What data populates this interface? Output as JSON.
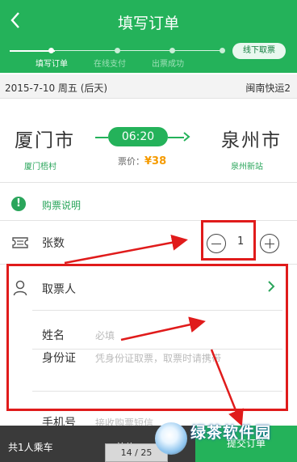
{
  "header": {
    "back_icon": "chevron-left-icon",
    "title": "填写订单"
  },
  "steps": {
    "items": [
      {
        "label": "填写订单",
        "active": true
      },
      {
        "label": "在线支付",
        "active": false
      },
      {
        "label": "出票成功",
        "active": false
      }
    ],
    "offline_button": "线下取票"
  },
  "trip": {
    "date": "2015-7-10 周五 (后天)",
    "company": "闽南快运2",
    "from_city": "厦门市",
    "from_station": "厦门梧村",
    "to_city": "泉州市",
    "to_station": "泉州新站",
    "time": "06:20",
    "fare_label": "票价：",
    "fare_value": "¥38"
  },
  "notice": {
    "icon": "exclamation-icon",
    "text": "购票说明"
  },
  "tickets": {
    "icon": "ticket-icon",
    "label": "张数",
    "quantity": "1"
  },
  "pickup": {
    "icon": "person-icon",
    "label": "取票人",
    "chevron": "chevron-right-icon"
  },
  "form": {
    "name_label": "姓名",
    "name_placeholder": "必填",
    "id_label": "身份证",
    "id_placeholder": "凭身份证取票，取票时请携带",
    "phone_label": "手机号",
    "phone_placeholder": "接收购票短信"
  },
  "bottom": {
    "passengers": "共1人乘车",
    "total_label": "总价：",
    "submit_label": "提交订单",
    "pager": "14 / 25",
    "watermark": "绿茶软件园"
  },
  "colors": {
    "brand_green": "#24b25a",
    "annotation_red": "#e01b1b",
    "price_orange": "#f59b00"
  }
}
